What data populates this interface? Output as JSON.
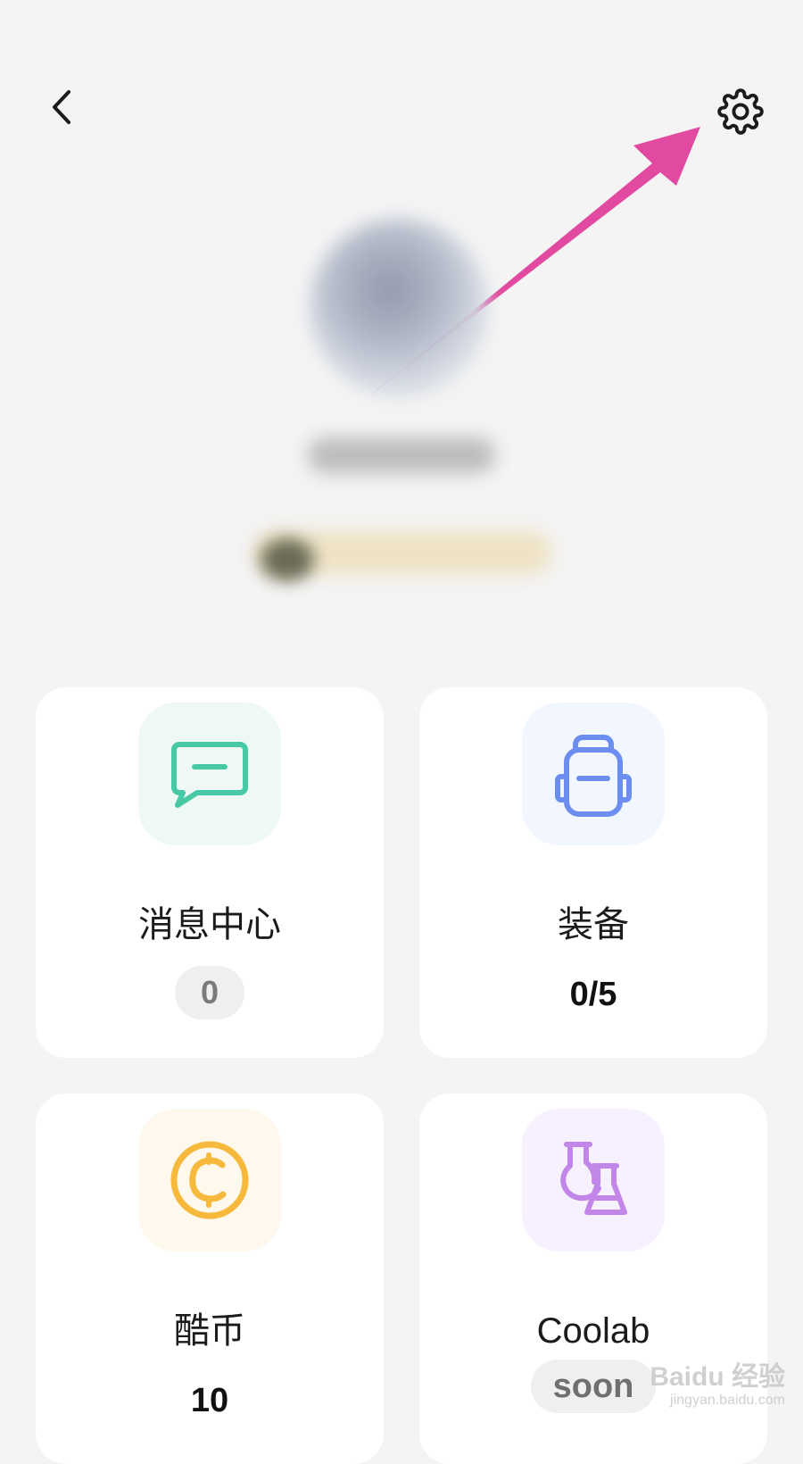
{
  "cards": {
    "messages": {
      "title": "消息中心",
      "value": "0"
    },
    "equipment": {
      "title": "装备",
      "value": "0/5"
    },
    "coins": {
      "title": "酷币",
      "value": "10"
    },
    "coolab": {
      "title": "Coolab",
      "value": "soon"
    }
  },
  "watermark": {
    "brand": "Baidu 经验",
    "site": "jingyan.baidu.com"
  },
  "colors": {
    "background": "#f4f4f4",
    "card": "#ffffff",
    "messages_accent": "#48c9a5",
    "equipment_accent": "#6b8ef0",
    "coins_accent": "#f6b93b",
    "coolab_accent": "#c186e8",
    "arrow": "#e14aa0"
  },
  "icons": {
    "back": "chevron-left-icon",
    "settings": "gear-icon",
    "messages": "message-bubble-icon",
    "equipment": "backpack-icon",
    "coins": "coin-icon",
    "coolab": "lab-flask-icon"
  }
}
